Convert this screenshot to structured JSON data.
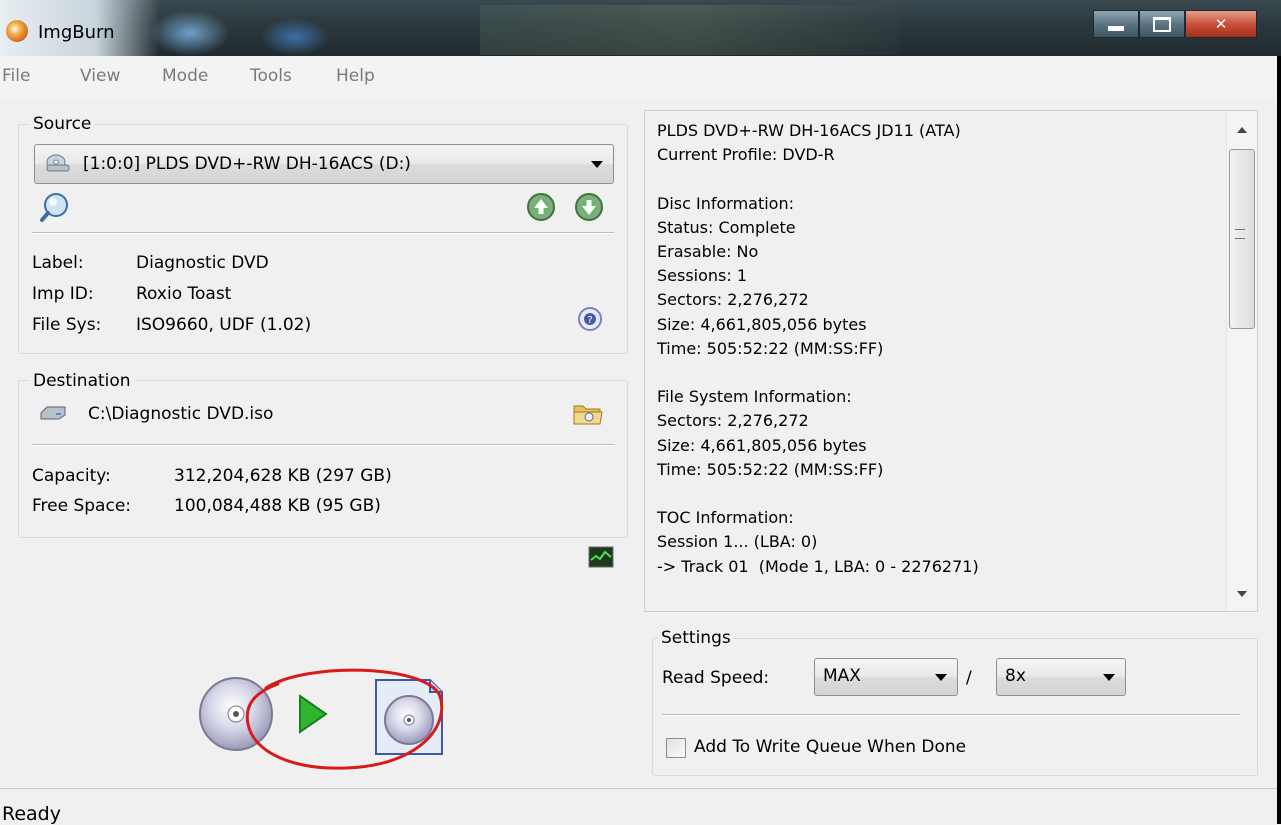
{
  "window": {
    "title": "ImgBurn"
  },
  "menu": [
    "File",
    "View",
    "Mode",
    "Tools",
    "Help"
  ],
  "source": {
    "group_title": "Source",
    "drive": "[1:0:0] PLDS DVD+-RW DH-16ACS (D:)",
    "label_key": "Label:",
    "label_val": "Diagnostic DVD",
    "imp_key": "Imp ID:",
    "imp_val": "Roxio Toast",
    "fs_key": "File Sys:",
    "fs_val": "ISO9660, UDF (1.02)"
  },
  "destination": {
    "group_title": "Destination",
    "path": "C:\\Diagnostic DVD.iso",
    "capacity_key": "Capacity:",
    "capacity_val": "312,204,628 KB  (297 GB)",
    "free_key": "Free Space:",
    "free_val": "100,084,488 KB  (95 GB)"
  },
  "info_lines": [
    "PLDS DVD+-RW DH-16ACS JD11 (ATA)",
    "Current Profile: DVD-R",
    "",
    "Disc Information:",
    "Status: Complete",
    "Erasable: No",
    "Sessions: 1",
    "Sectors: 2,276,272",
    "Size: 4,661,805,056 bytes",
    "Time: 505:52:22 (MM:SS:FF)",
    "",
    "File System Information:",
    "Sectors: 2,276,272",
    "Size: 4,661,805,056 bytes",
    "Time: 505:52:22 (MM:SS:FF)",
    "",
    "TOC Information:",
    "Session 1... (LBA: 0)",
    "-> Track 01  (Mode 1, LBA: 0 - 2276271)"
  ],
  "settings": {
    "group_title": "Settings",
    "read_speed_label": "Read Speed:",
    "read_speed_value": "MAX",
    "slash": "/",
    "speed2_value": "8x",
    "queue_label": "Add To Write Queue When Done",
    "queue_checked": false
  },
  "status": "Ready",
  "colors": {
    "annotation": "#d81a1a",
    "play_green": "#27a827"
  }
}
